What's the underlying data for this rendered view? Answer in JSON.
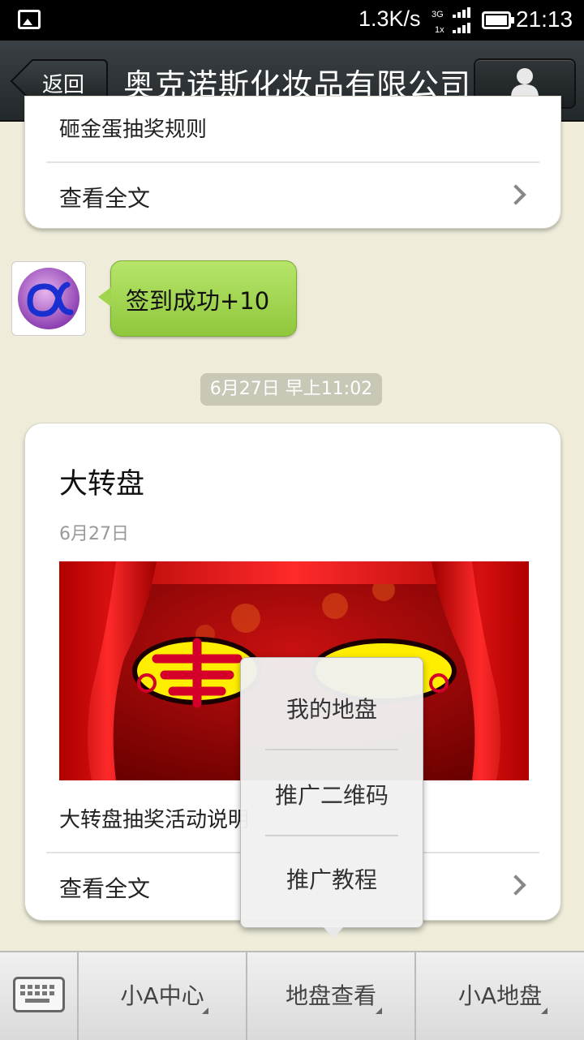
{
  "status_bar": {
    "network_speed": "1.3K/s",
    "time": "21:13",
    "network_type_top": "3G",
    "network_type_bottom": "1x",
    "icons": [
      "image-notification-icon",
      "signal-icon",
      "battery-icon"
    ]
  },
  "header": {
    "back_label": "返回",
    "title": "奥克诺斯化妆品有限公司",
    "profile_icon": "user-icon"
  },
  "messages": {
    "card1": {
      "truncated_title": "砸金蛋抽奖规则",
      "read_more": "查看全文"
    },
    "checkin_bubble": {
      "text": "签到成功+10"
    },
    "timestamp": "6月27日 早上11:02",
    "card2": {
      "title": "大转盘",
      "date": "6月27日",
      "description": "大转盘抽奖活动说明",
      "read_more": "查看全文"
    }
  },
  "popup_menu": {
    "items": [
      "我的地盘",
      "推广二维码",
      "推广教程"
    ]
  },
  "bottom_menu": {
    "keyboard_icon": "keyboard-icon",
    "buttons": [
      "小A中心",
      "地盘查看",
      "小A地盘"
    ]
  },
  "colors": {
    "background": "#efedda",
    "bubble_green": "#a0d34e",
    "titlebar": "#2c3235"
  }
}
